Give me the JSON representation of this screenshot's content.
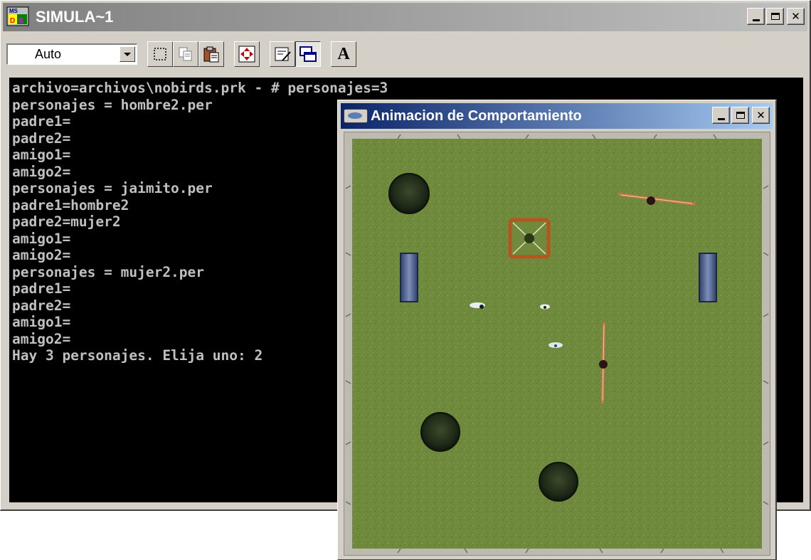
{
  "console_window": {
    "title": "SIMULA~1",
    "buttons": {
      "minimize": "_",
      "maximize": "□",
      "close": "×"
    },
    "toolbar": {
      "font_size_select": "Auto",
      "buttons": [
        "mark-icon",
        "copy-icon",
        "paste-icon",
        "fullscreen-icon",
        "properties-icon",
        "background-icon",
        "font-icon"
      ],
      "font_button_label": "A"
    },
    "lines": [
      "archivo=archivos\\nobirds.prk - # personajes=3",
      "personajes = hombre2.per",
      "padre1=",
      "padre2=",
      "amigo1=",
      "amigo2=",
      "personajes = jaimito.per",
      "padre1=hombre2",
      "padre2=mujer2",
      "amigo1=",
      "amigo2=",
      "personajes = mujer2.per",
      "padre1=",
      "padre2=",
      "amigo1=",
      "amigo2=",
      "Hay 3 personajes. Elija uno: 2"
    ]
  },
  "animation_window": {
    "title": "Animacion de Comportamiento",
    "colors": {
      "grass": "#6f8a3c",
      "wall": "#bdbab2",
      "bench_wood": "#c8744a",
      "tree": "#1f2a18",
      "water": "#3a4f7e",
      "sandbox": "#c0622a"
    }
  }
}
